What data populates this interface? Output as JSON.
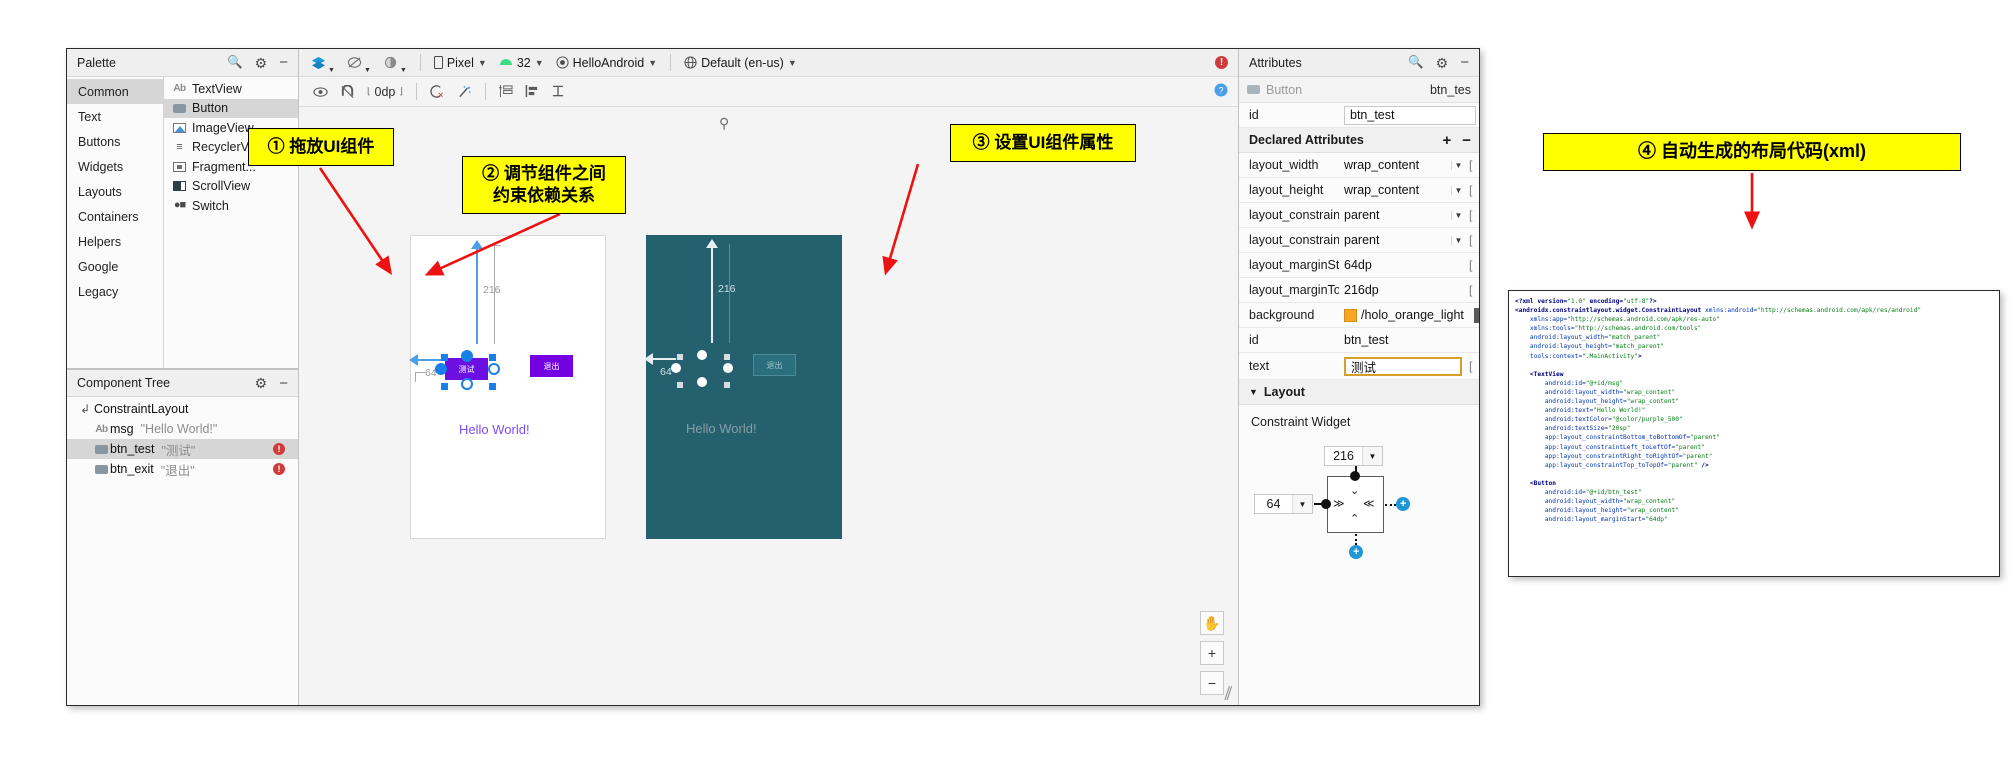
{
  "palette": {
    "title": "Palette",
    "search_icon": "search-icon",
    "gear_icon": "gear-icon",
    "minimize_icon": "minimize-icon",
    "categories": [
      {
        "label": "Common",
        "selected": true
      },
      {
        "label": "Text",
        "selected": false
      },
      {
        "label": "Buttons",
        "selected": false
      },
      {
        "label": "Widgets",
        "selected": false
      },
      {
        "label": "Layouts",
        "selected": false
      },
      {
        "label": "Containers",
        "selected": false
      },
      {
        "label": "Helpers",
        "selected": false
      },
      {
        "label": "Google",
        "selected": false
      },
      {
        "label": "Legacy",
        "selected": false
      }
    ],
    "items": [
      {
        "label": "TextView",
        "icon": "textview-icon",
        "selected": false
      },
      {
        "label": "Button",
        "icon": "button-icon",
        "selected": true
      },
      {
        "label": "ImageView",
        "icon": "imageview-icon",
        "selected": false
      },
      {
        "label": "RecyclerVi...",
        "icon": "recyclerview-icon",
        "selected": false
      },
      {
        "label": "Fragment...",
        "icon": "fragment-icon",
        "selected": false
      },
      {
        "label": "ScrollView",
        "icon": "scrollview-icon",
        "selected": false
      },
      {
        "label": "Switch",
        "icon": "switch-icon",
        "selected": false
      }
    ]
  },
  "component_tree": {
    "title": "Component Tree",
    "gear_icon": "gear-icon",
    "minimize_icon": "minimize-icon",
    "nodes": [
      {
        "name": "ConstraintLayout",
        "value": "",
        "icon": "constraintlayout-icon",
        "indent": 0,
        "selected": false,
        "error": false
      },
      {
        "name": "msg",
        "value": "\"Hello World!\"",
        "icon": "textview-icon",
        "indent": 1,
        "selected": false,
        "error": false
      },
      {
        "name": "btn_test",
        "value": "\"测试\"",
        "icon": "button-icon",
        "indent": 1,
        "selected": true,
        "error": true
      },
      {
        "name": "btn_exit",
        "value": "\"退出\"",
        "icon": "button-icon",
        "indent": 1,
        "selected": false,
        "error": true
      }
    ]
  },
  "editor_toolbar": {
    "design_mode_icon": "layers-icon",
    "blueprint_mode_icon": "blueprint-icon",
    "theme_icon": "theme-icon",
    "device": "Pixel",
    "api_level": "32",
    "theme": "HelloAndroid",
    "locale": "Default (en-us)",
    "warning_icon": "error-icon",
    "help_icon": "help-icon",
    "device_icon": "phone-icon",
    "android_icon": "android-icon",
    "theme_circle_icon": "theme-circle-icon",
    "globe_icon": "globe-icon"
  },
  "design_toolbar": {
    "view_options_icon": "eye-icon",
    "autoconnect_icon": "magnet-off-icon",
    "default_margin": "0dp",
    "clear_constraints_icon": "clear-constraints-icon",
    "infer_constraints_icon": "magic-wand-icon",
    "guidelines_icon": "guidelines-icon",
    "align_icon": "align-icon",
    "baseline_icon": "baseline-icon"
  },
  "canvas": {
    "hello_world_text": "Hello World!",
    "selected_button_text": "测试",
    "exit_button_text": "退出",
    "margin_top": "216",
    "margin_start": "64",
    "pin_icon": "pin-icon",
    "pan_icon": "pan-hand-icon",
    "zoom_in": "+",
    "zoom_out": "−",
    "resize_grip_icon": "resize-grip-icon"
  },
  "attributes": {
    "title": "Attributes",
    "search_icon": "search-icon",
    "gear_icon": "gear-icon",
    "minimize_icon": "minimize-icon",
    "widget_type": "Button",
    "widget_id_display": "btn_tes",
    "widget_icon": "button-icon",
    "id_label": "id",
    "id_value": "btn_test",
    "declared_section": "Declared Attributes",
    "add_icon": "+",
    "remove_icon": "−",
    "rows": [
      {
        "key": "layout_width",
        "value": "wrap_content",
        "dropdown": true,
        "color": false,
        "focus": false
      },
      {
        "key": "layout_height",
        "value": "wrap_content",
        "dropdown": true,
        "color": false,
        "focus": false
      },
      {
        "key": "layout_constraint...",
        "value": "parent",
        "dropdown": true,
        "color": false,
        "focus": false
      },
      {
        "key": "layout_constraint...",
        "value": "parent",
        "dropdown": true,
        "color": false,
        "focus": false
      },
      {
        "key": "layout_marginSt...",
        "value": "64dp",
        "dropdown": false,
        "color": false,
        "focus": false
      },
      {
        "key": "layout_marginTop",
        "value": "216dp",
        "dropdown": false,
        "color": false,
        "focus": false
      },
      {
        "key": "background",
        "value": "/holo_orange_light",
        "dropdown": false,
        "color": true,
        "focus": false
      },
      {
        "key": "id",
        "value": "btn_test",
        "dropdown": false,
        "color": false,
        "focus": false
      },
      {
        "key": "text",
        "value": "测试",
        "dropdown": false,
        "color": false,
        "focus": true
      }
    ],
    "layout_section": "Layout",
    "constraint_widget_title": "Constraint Widget",
    "constraint_top_value": "216",
    "constraint_start_value": "64",
    "background_color": "#f6a621"
  },
  "xml": {
    "lines": [
      {
        "indent": 0,
        "parts": [
          {
            "t": "<?xml version=",
            "c": "tag"
          },
          {
            "t": "\"1.0\"",
            "c": "str"
          },
          {
            "t": " encoding=",
            "c": "tag"
          },
          {
            "t": "\"utf-8\"",
            "c": "str"
          },
          {
            "t": "?>",
            "c": "tag"
          }
        ]
      },
      {
        "indent": 0,
        "parts": [
          {
            "t": "<androidx.constraintlayout.widget.ConstraintLayout ",
            "c": "tag"
          },
          {
            "t": "xmlns:android=",
            "c": "attr"
          },
          {
            "t": "\"http://schemas.android.com/apk/res/android\"",
            "c": "str"
          }
        ]
      },
      {
        "indent": 1,
        "parts": [
          {
            "t": "xmlns:app=",
            "c": "attr"
          },
          {
            "t": "\"http://schemas.android.com/apk/res-auto\"",
            "c": "str"
          }
        ]
      },
      {
        "indent": 1,
        "parts": [
          {
            "t": "xmlns:tools=",
            "c": "attr"
          },
          {
            "t": "\"http://schemas.android.com/tools\"",
            "c": "str"
          }
        ]
      },
      {
        "indent": 1,
        "parts": [
          {
            "t": "android:layout_width=",
            "c": "attr"
          },
          {
            "t": "\"match_parent\"",
            "c": "str"
          }
        ]
      },
      {
        "indent": 1,
        "parts": [
          {
            "t": "android:layout_height=",
            "c": "attr"
          },
          {
            "t": "\"match_parent\"",
            "c": "str"
          }
        ]
      },
      {
        "indent": 1,
        "parts": [
          {
            "t": "tools:context=",
            "c": "attr"
          },
          {
            "t": "\".MainActivity\"",
            "c": "str"
          },
          {
            "t": ">",
            "c": "tag"
          }
        ]
      },
      {
        "indent": 0,
        "parts": []
      },
      {
        "indent": 1,
        "parts": [
          {
            "t": "<TextView",
            "c": "tag"
          }
        ]
      },
      {
        "indent": 2,
        "parts": [
          {
            "t": "android:id=",
            "c": "attr"
          },
          {
            "t": "\"@+id/msg\"",
            "c": "str"
          }
        ]
      },
      {
        "indent": 2,
        "parts": [
          {
            "t": "android:layout_width=",
            "c": "attr"
          },
          {
            "t": "\"wrap_content\"",
            "c": "str"
          }
        ]
      },
      {
        "indent": 2,
        "parts": [
          {
            "t": "android:layout_height=",
            "c": "attr"
          },
          {
            "t": "\"wrap_content\"",
            "c": "str"
          }
        ]
      },
      {
        "indent": 2,
        "parts": [
          {
            "t": "android:text=",
            "c": "attr"
          },
          {
            "t": "\"Hello World!\"",
            "c": "str"
          }
        ]
      },
      {
        "indent": 2,
        "parts": [
          {
            "t": "android:textColor=",
            "c": "attr"
          },
          {
            "t": "\"@color/purple_500\"",
            "c": "str"
          }
        ]
      },
      {
        "indent": 2,
        "parts": [
          {
            "t": "android:textSize=",
            "c": "attr"
          },
          {
            "t": "\"20sp\"",
            "c": "str"
          }
        ]
      },
      {
        "indent": 2,
        "parts": [
          {
            "t": "app:layout_constraintBottom_toBottomOf=",
            "c": "attr"
          },
          {
            "t": "\"parent\"",
            "c": "str"
          }
        ]
      },
      {
        "indent": 2,
        "parts": [
          {
            "t": "app:layout_constraintLeft_toLeftOf=",
            "c": "attr"
          },
          {
            "t": "\"parent\"",
            "c": "str"
          }
        ]
      },
      {
        "indent": 2,
        "parts": [
          {
            "t": "app:layout_constraintRight_toRightOf=",
            "c": "attr"
          },
          {
            "t": "\"parent\"",
            "c": "str"
          }
        ]
      },
      {
        "indent": 2,
        "parts": [
          {
            "t": "app:layout_constraintTop_toTopOf=",
            "c": "attr"
          },
          {
            "t": "\"parent\"",
            "c": "str"
          },
          {
            "t": " />",
            "c": "tag"
          }
        ]
      },
      {
        "indent": 0,
        "parts": []
      },
      {
        "indent": 1,
        "parts": [
          {
            "t": "<Button",
            "c": "tag"
          }
        ]
      },
      {
        "indent": 2,
        "parts": [
          {
            "t": "android:id=",
            "c": "attr"
          },
          {
            "t": "\"@+id/btn_test\"",
            "c": "str"
          }
        ]
      },
      {
        "indent": 2,
        "parts": [
          {
            "t": "android:layout_width=",
            "c": "attr"
          },
          {
            "t": "\"wrap_content\"",
            "c": "str"
          }
        ]
      },
      {
        "indent": 2,
        "parts": [
          {
            "t": "android:layout_height=",
            "c": "attr"
          },
          {
            "t": "\"wrap_content\"",
            "c": "str"
          }
        ]
      },
      {
        "indent": 2,
        "parts": [
          {
            "t": "android:layout_marginStart=",
            "c": "attr"
          },
          {
            "t": "\"64dp\"",
            "c": "str"
          }
        ]
      }
    ]
  },
  "annotations": {
    "note1": "① 拖放UI组件",
    "note2_line1": "② 调节组件之间",
    "note2_line2": "约束依赖关系",
    "note3": "③ 设置UI组件属性",
    "note4": "④ 自动生成的布局代码(xml)",
    "arrow_color": "#ee1111"
  }
}
